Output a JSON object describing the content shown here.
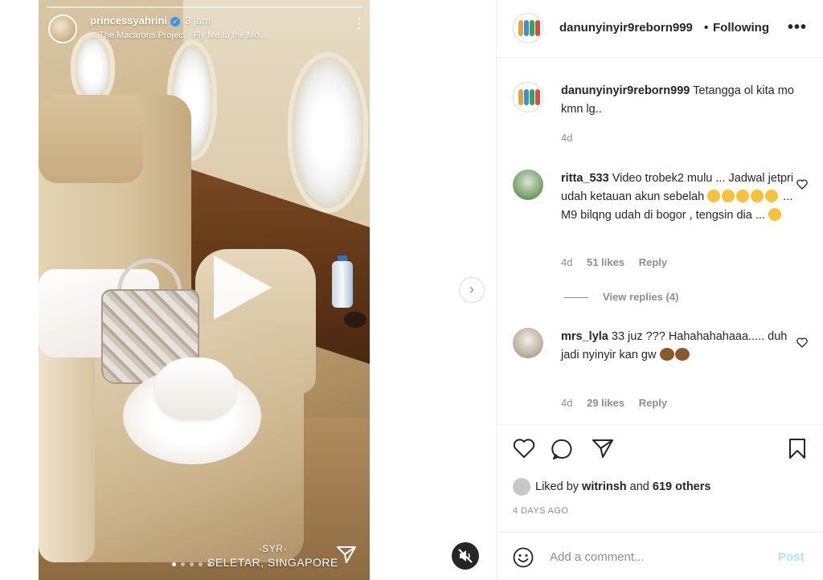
{
  "story": {
    "username": "princessyahrini",
    "verified_mark": "✓",
    "time": "3 jam",
    "music": "♫ The Macarons Project · Fly Me to the Mo...",
    "more_label": "⋮",
    "location_tag": "-SYR-",
    "location": "SELETAR, SINGAPORE",
    "play_icon": "play-icon",
    "share_icon": "send-icon"
  },
  "media_controls": {
    "next_label": "›",
    "mute_icon": "speaker-muted-icon"
  },
  "post": {
    "username": "danunyinyir9reborn999",
    "separator": "•",
    "follow_status": "Following",
    "more_label": "•••"
  },
  "comments": [
    {
      "username": "danunyinyir9reborn999",
      "text": "Tetangga ol kita mo kmn lg..",
      "time": "4d"
    },
    {
      "username": "ritta_533",
      "text_1": "Video trobek2 mulu ... Jadwal jetpri udah ketauan akun sebelah",
      "text_2": "... M9 bilqng udah di bogor , tengsin dia ...",
      "time": "4d",
      "likes": "51 likes",
      "reply": "Reply",
      "view_replies": "View replies (4)"
    },
    {
      "username": "mrs_lyla",
      "text": "33 juz ??? Hahahahahaaa..... duh jadi nyinyir kan gw",
      "time": "4d",
      "likes": "29 likes",
      "reply": "Reply"
    }
  ],
  "actions": {
    "liked_by_prefix": "Liked by",
    "liked_by_user": "witrinsh",
    "and": "and",
    "others": "619 others",
    "date": "4 DAYS AGO"
  },
  "add_comment": {
    "placeholder": "Add a comment...",
    "post_label": "Post"
  },
  "colors": {
    "text": "#262626",
    "secondary": "#8e8e8e",
    "post_button_disabled": "#b2dffc",
    "border": "#efefef"
  }
}
